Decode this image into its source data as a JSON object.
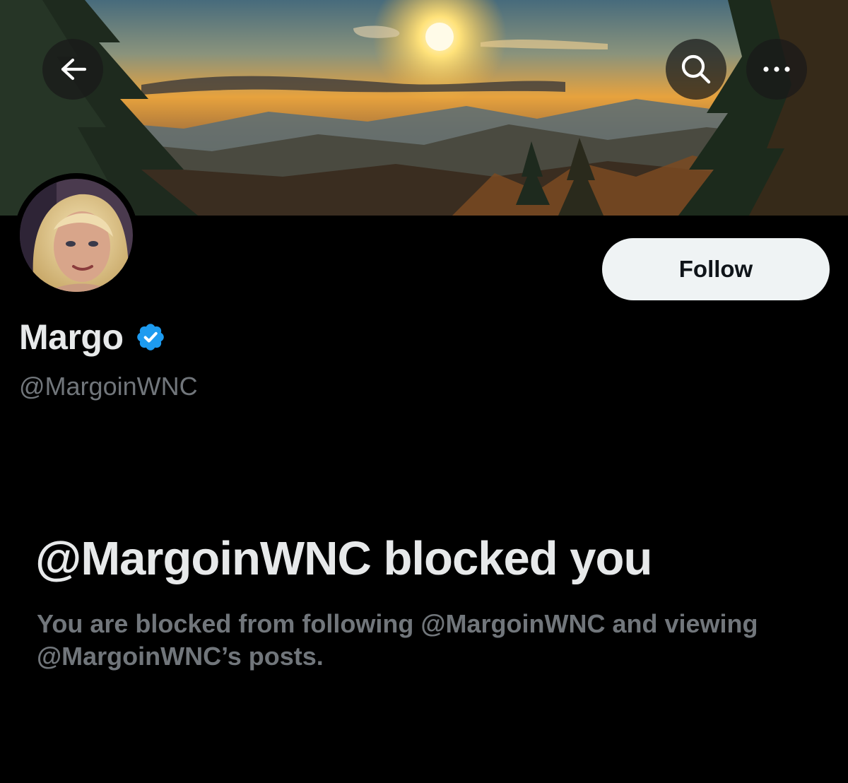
{
  "header": {
    "back_icon": "arrow-left-icon",
    "search_icon": "search-icon",
    "more_icon": "more-horizontal-icon"
  },
  "profile": {
    "display_name": "Margo",
    "verified_icon": "verified-badge-icon",
    "verified_color": "#1d9bf0",
    "handle": "@MargoinWNC",
    "follow_label": "Follow"
  },
  "blocked": {
    "title": "@MargoinWNC blocked you",
    "description": "You are blocked from following @MargoinWNC and viewing @MargoinWNC’s posts."
  },
  "colors": {
    "background": "#000000",
    "primary_text": "#e7e9ea",
    "secondary_text": "#71767b",
    "button_bg": "#eff3f4",
    "button_text": "#0f1419"
  }
}
